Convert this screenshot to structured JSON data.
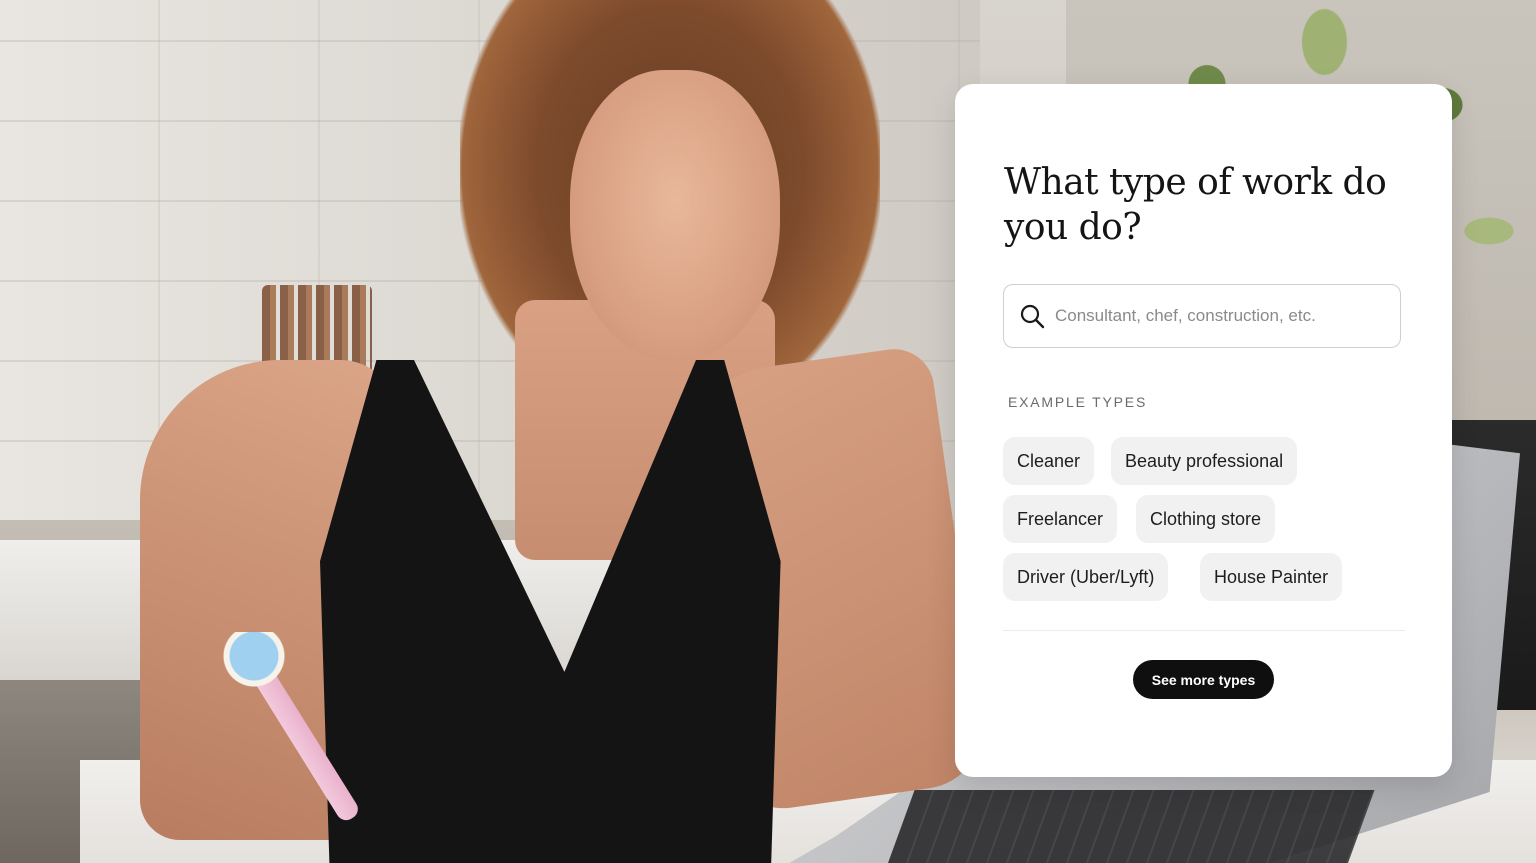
{
  "card": {
    "title": "What type of work do you do?",
    "search": {
      "placeholder": "Consultant, chef, construction, etc.",
      "value": ""
    },
    "examples_label": "EXAMPLE TYPES",
    "chips": [
      {
        "label": "Cleaner"
      },
      {
        "label": "Beauty professional"
      },
      {
        "label": "Freelancer"
      },
      {
        "label": "Clothing store"
      },
      {
        "label": "Driver (Uber/Lyft)"
      },
      {
        "label": "House Painter"
      }
    ],
    "see_more_label": "See more types"
  },
  "icons": {
    "search": "search-icon"
  },
  "colors": {
    "card_background": "#ffffff",
    "chip_background": "#f1f1f1",
    "button_background": "#0f0f0f",
    "button_text": "#ffffff",
    "title_text": "#141414"
  }
}
